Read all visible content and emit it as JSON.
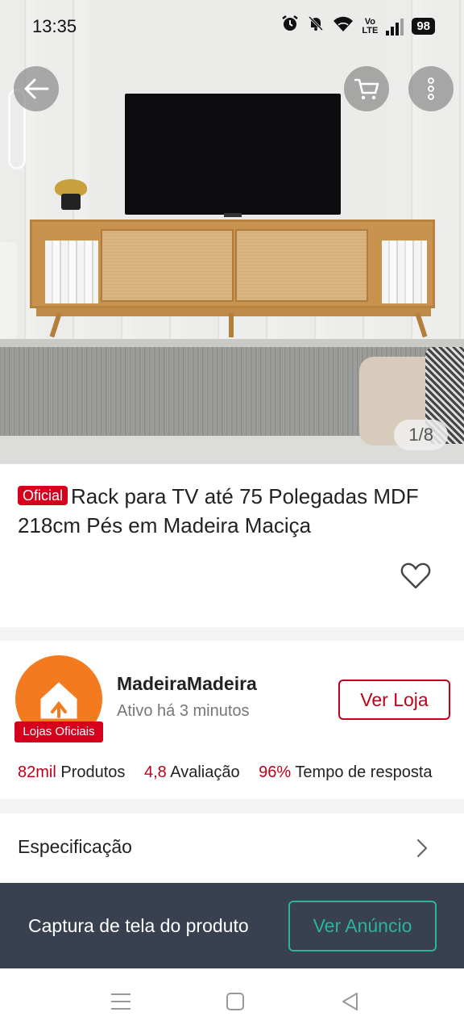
{
  "status_bar": {
    "time": "13:35",
    "volte_top": "Vo",
    "volte_bottom": "LTE",
    "battery": "98",
    "icons": [
      "alarm-icon",
      "mute-bell-icon",
      "wifi-icon",
      "volte-icon",
      "signal-icon",
      "battery-icon"
    ]
  },
  "hero": {
    "image_counter": "1/8",
    "buttons": [
      "back-arrow-icon",
      "cart-icon",
      "more-vertical-icon"
    ]
  },
  "product": {
    "badge": "Oficial",
    "title": "Rack para TV até 75 Polegadas MDF 218cm Pés em Madeira Maciça",
    "icons": [
      "heart-icon"
    ]
  },
  "store": {
    "name": "MadeiraMadeira",
    "status": "Ativo há 3 minutos",
    "logo_ribbon": "Lojas Oficiais",
    "visit_button": "Ver Loja",
    "stats": [
      {
        "value": "82mil",
        "label": "Produtos"
      },
      {
        "value": "4,8",
        "label": "Avaliação"
      },
      {
        "value": "96%",
        "label": "Tempo de resposta"
      }
    ]
  },
  "specification": {
    "label": "Especificação",
    "icons": [
      "chevron-right-icon"
    ]
  },
  "snackbar": {
    "text": "Captura de tela do produto",
    "button": "Ver Anúncio"
  },
  "navigation": {
    "icons": [
      "recent-apps-icon",
      "home-icon",
      "back-icon"
    ]
  },
  "colors": {
    "accent_red": "#c0001b",
    "badge_red": "#d7001c",
    "snackbar_bg": "#39404f",
    "snackbar_accent": "#2bb3a0",
    "logo_orange": "#f47a20"
  }
}
